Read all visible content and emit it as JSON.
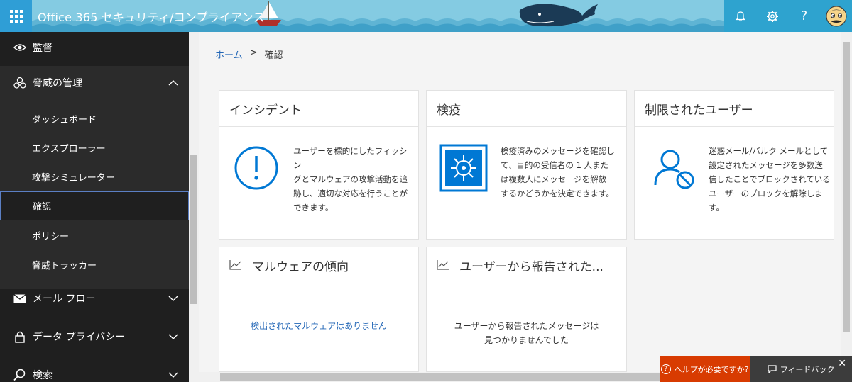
{
  "header": {
    "app_title": "Office 365 セキュリティ/コンプライアンス",
    "actions": [
      {
        "icon": "bell-icon",
        "label": "通知"
      },
      {
        "icon": "gear-icon",
        "label": "設定"
      },
      {
        "icon": "question-icon",
        "glyph": "?"
      },
      {
        "icon": "avatar-icon"
      }
    ]
  },
  "sidebar": {
    "items": [
      {
        "icon": "eye-icon",
        "label": "監督"
      },
      {
        "icon": "biohazard-icon",
        "label": "脅威の管理",
        "expanded": true,
        "children": [
          {
            "label": "ダッシュボード"
          },
          {
            "label": "エクスプローラー"
          },
          {
            "label": "攻撃シミュレーター"
          },
          {
            "label": "確認",
            "selected": true
          },
          {
            "label": "ポリシー"
          },
          {
            "label": "脅威トラッカー"
          }
        ]
      },
      {
        "icon": "mail-icon",
        "label": "メール フロー"
      },
      {
        "icon": "lock-icon",
        "label": "データ プライバシー"
      },
      {
        "icon": "search-icon",
        "label": "検索"
      }
    ]
  },
  "breadcrumb": {
    "home": "ホーム",
    "separator": ">",
    "current": "確認"
  },
  "cards": {
    "incidents": {
      "title": "インシデント",
      "icon": "alert-circle-icon",
      "text_lines": [
        "ユーザーを標的にしたフィッシン",
        "グとマルウェアの攻撃活動を追",
        "跡し、適切な対応を行うことが",
        "できます。"
      ]
    },
    "quarantine": {
      "title": "検疫",
      "icon": "vault-icon",
      "text_lines": [
        "検疫済みのメッセージを確認し",
        "て、目的の受信者の 1 人また",
        "は複数人にメッセージを解放",
        "するかどうかを決定できます。"
      ]
    },
    "restricted_users": {
      "title": "制限されたユーザー",
      "icon": "user-blocked-icon",
      "text_lines": [
        "迷惑メール/バルク メールとして",
        "設定されたメッセージを多数送",
        "信したことでブロックされている",
        "ユーザーのブロックを解除しま",
        "す。"
      ]
    },
    "malware_trend": {
      "title": "マルウェアの傾向",
      "icon": "trend-chart-icon",
      "message": "検出されたマルウェアはありません"
    },
    "user_reported": {
      "title": "ユーザーから報告された...",
      "icon": "trend-chart-icon",
      "message_lines": [
        "ユーザーから報告されたメッセージは",
        "見つかりませんでした"
      ]
    }
  },
  "footer": {
    "help_label": "ヘルプが必要ですか?",
    "feedback_label": "フィードバック",
    "close_glyph": "✕"
  },
  "colors": {
    "accent": "#0078d4",
    "header_bg": "#7fc6de",
    "help_bg": "#d83b01",
    "sidebar_bg": "#1f1f1f"
  }
}
